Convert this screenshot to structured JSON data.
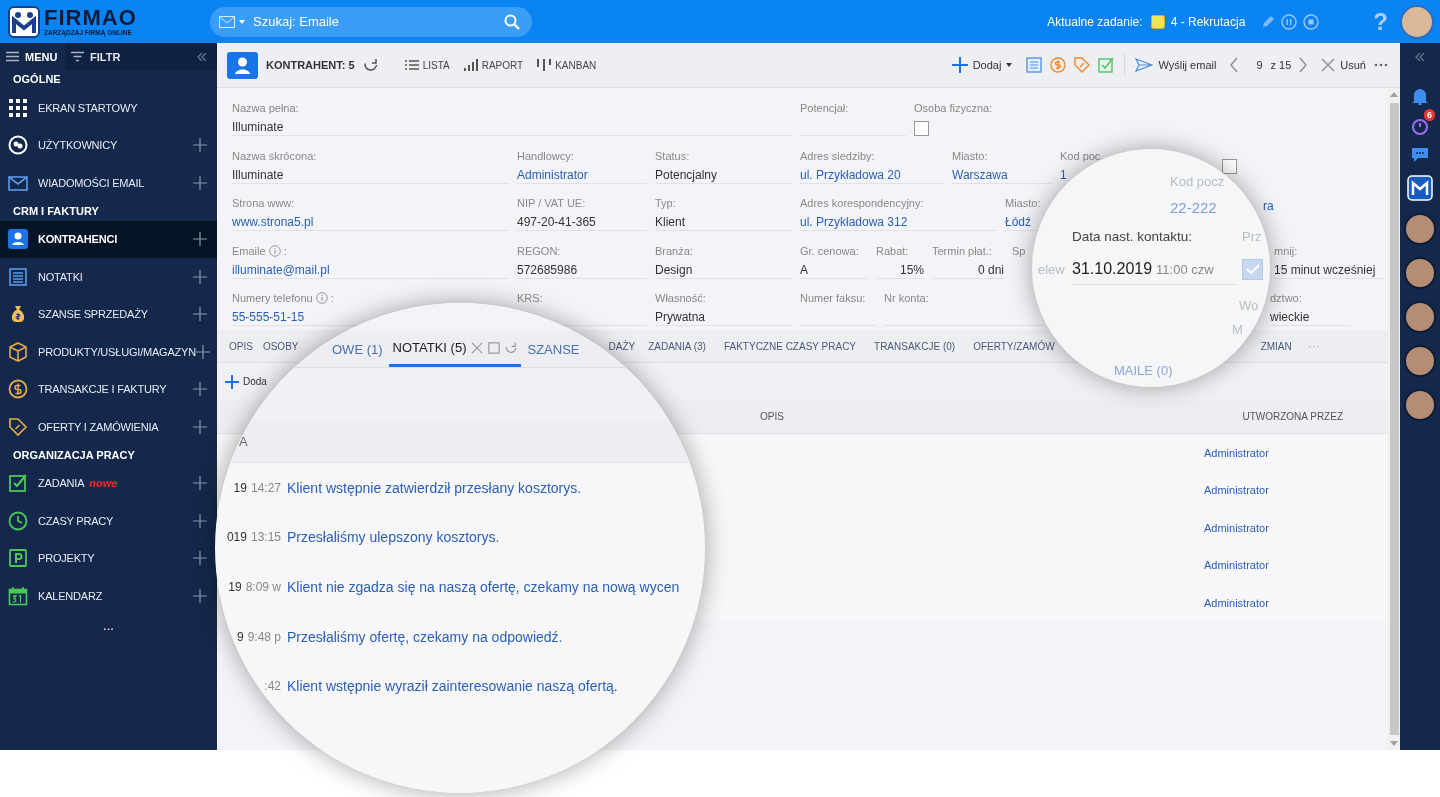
{
  "header": {
    "logo": {
      "name": "FIRMAO",
      "tagline": "ZARZĄDZAJ FIRMĄ ONLINE"
    },
    "search": {
      "placeholder": "Szukaj: Emaile"
    },
    "current_task": {
      "label": "Aktualne zadanie:",
      "name": "4 - Rekrutacja"
    },
    "help": "?"
  },
  "sidebar": {
    "tabs": [
      {
        "label": "MENU",
        "selected": true
      },
      {
        "label": "FILTR",
        "selected": false
      }
    ],
    "sections": [
      {
        "title": "OGÓLNE",
        "items": [
          {
            "label": "EKRAN STARTOWY",
            "kind": "grid",
            "selected": false,
            "addable": false
          },
          {
            "label": "UŻYTKOWNICY",
            "kind": "users",
            "selected": false,
            "addable": true
          },
          {
            "label": "WIADOMOŚCI EMAIL",
            "kind": "mail",
            "selected": false,
            "addable": true
          }
        ]
      },
      {
        "title": "CRM I FAKTURY",
        "items": [
          {
            "label": "KONTRAHENCI",
            "kind": "contact",
            "selected": true,
            "addable": true
          },
          {
            "label": "NOTATKI",
            "kind": "notes",
            "selected": false,
            "addable": true
          },
          {
            "label": "SZANSE SPRZEDAŻY",
            "kind": "bag",
            "selected": false,
            "addable": true
          },
          {
            "label": "PRODUKTY/USŁUGI/MAGAZYN",
            "kind": "box",
            "selected": false,
            "addable": true
          },
          {
            "label": "TRANSAKCJE I FAKTURY",
            "kind": "dollar",
            "selected": false,
            "addable": true
          },
          {
            "label": "OFERTY I ZAMÓWIENIA",
            "kind": "tag",
            "selected": false,
            "addable": true
          }
        ]
      },
      {
        "title": "ORGANIZACJA PRACY",
        "items": [
          {
            "label": "ZADANIA",
            "badge": "nowe",
            "kind": "check",
            "selected": false,
            "addable": true
          },
          {
            "label": "CZASY PRACY",
            "kind": "clock",
            "selected": false,
            "addable": true
          },
          {
            "label": "PROJEKTY",
            "kind": "project",
            "selected": false,
            "addable": true
          },
          {
            "label": "KALENDARZ",
            "kind": "calendar",
            "selected": false,
            "addable": true
          }
        ]
      }
    ],
    "more": "..."
  },
  "toolbar": {
    "title": "KONTRAHENT: 5",
    "views": [
      {
        "label": "LISTA",
        "kind": "list"
      },
      {
        "label": "RAPORT",
        "kind": "report"
      },
      {
        "label": "KANBAN",
        "kind": "kanban"
      }
    ],
    "add": "Dodaj",
    "send_email": "Wyślij email",
    "pager": {
      "current": "9",
      "total": "z 15"
    },
    "delete": "Usuń"
  },
  "form": {
    "rows": [
      {
        "fields": [
          {
            "label": "Nazwa pełna:",
            "value": "Illuminate",
            "kind": "text"
          },
          {
            "label": "Potencjał:",
            "kind": "text"
          },
          {
            "label": "Osoba fizyczna:",
            "kind": "checkbox",
            "checked": false
          }
        ]
      },
      {
        "fields": [
          {
            "label": "Nazwa skrócona:",
            "value": "Illuminate",
            "kind": "text"
          },
          {
            "label": "Handlowcy:",
            "value": "Administrator",
            "kind": "link"
          },
          {
            "label": "Status:",
            "value": "Potencjalny",
            "kind": "text"
          },
          {
            "label": "Adres siedziby:",
            "value": "ul. Przykładowa 20",
            "kind": "link"
          },
          {
            "label": "Miasto:",
            "value": "Warszawa",
            "kind": "link"
          },
          {
            "label": "Kod poc",
            "value": "1",
            "kind": "link"
          },
          {
            "kind": "checkbox",
            "checked": false
          }
        ]
      },
      {
        "fields": [
          {
            "label": "Strona www:",
            "value": "www.strona5.pl",
            "kind": "link"
          },
          {
            "label": "NIP / VAT UE:",
            "value": "497-20-41-365",
            "kind": "text"
          },
          {
            "label": "Typ:",
            "value": "Klient",
            "kind": "text"
          },
          {
            "label": "Adres korespondencyjny:",
            "value": "ul. Przykładowa 312",
            "kind": "link"
          },
          {
            "label": "Miasto:",
            "value": "Łódź",
            "kind": "link"
          },
          {
            "value": "ra",
            "kind": "link"
          }
        ]
      },
      {
        "fields": [
          {
            "label": "Emaile",
            "info": true,
            "suffix": ":",
            "value": "illuminate@mail.pl",
            "kind": "link"
          },
          {
            "label": "REGON:",
            "value": "572685986",
            "kind": "text"
          },
          {
            "label": "Branża:",
            "value": "Design",
            "kind": "text"
          },
          {
            "label": "Gr. cenowa:",
            "value": "A",
            "kind": "text"
          },
          {
            "label": "Rabat:",
            "value": "15%",
            "kind": "number"
          },
          {
            "label": "Termin płat.:",
            "value": "0 dni",
            "kind": "number"
          },
          {
            "label": "Sp",
            "kind": "text"
          },
          {
            "label": "mnij:",
            "value": "15 minut wcześniej",
            "kind": "text"
          }
        ]
      },
      {
        "fields": [
          {
            "label": "Numery telefonu",
            "info": true,
            "suffix": ":",
            "value": "55-555-51-15",
            "kind": "link"
          },
          {
            "label": "KRS:",
            "kind": "text"
          },
          {
            "label": "Własność:",
            "value": "Prywatna",
            "kind": "text"
          },
          {
            "label": "Numer faksu:",
            "kind": "text"
          },
          {
            "label": "Nr konta:",
            "kind": "text"
          },
          {
            "label": "dztwo:",
            "value": "wieckie",
            "kind": "text"
          }
        ]
      }
    ]
  },
  "tabs": {
    "items": [
      {
        "label": "OPIS",
        "selected": false
      },
      {
        "label": "OSOBY",
        "selected": false
      },
      {
        "label": "DAŻY",
        "selected": false
      },
      {
        "label": "ZADANIA (3)",
        "selected": false
      },
      {
        "label": "FAKTYCZNE CZASY PRACY",
        "selected": false
      },
      {
        "label": "TRANSAKCJE (0)",
        "selected": false
      },
      {
        "label": "OFERTY/ZAMÓW",
        "selected": false
      },
      {
        "label": "ZMIAN",
        "selected": false
      }
    ],
    "more": "···"
  },
  "notes": {
    "add": "Doda",
    "columns": [
      "OPIS",
      "UTWORZONA PRZEZ"
    ],
    "rows": [
      {
        "created_by": "Administrator"
      },
      {
        "created_by": "Administrator"
      },
      {
        "created_by": "Administrator"
      },
      {
        "created_by": "Administrator"
      },
      {
        "created_by": "Administrator"
      }
    ]
  },
  "magnifier_notes": {
    "tabs": [
      {
        "label": "OWE (1)",
        "selected": false
      },
      {
        "label": "NOTATKI (5)",
        "selected": true
      },
      {
        "label": "SZANSE",
        "selected": false
      }
    ],
    "header": "A",
    "rows": [
      {
        "date": "19",
        "time": "14:27",
        "description": "Klient wstępnie zatwierdził przesłany kosztorys."
      },
      {
        "date": "019",
        "time": "13:15",
        "description": "Przesłaliśmy ulepszony kosztorys."
      },
      {
        "date": "19",
        "time": "8:09 w",
        "description": "Klient nie zgadza się na naszą ofertę, czekamy na nową wycen"
      },
      {
        "date": "9",
        "time": "9:48 p",
        "description": "Przesłaliśmy ofertę, czekamy na odpowiedź."
      },
      {
        "time": ":42",
        "description": "Klient wstępnie wyraził zainteresowanie naszą ofertą."
      }
    ]
  },
  "magnifier_contact": {
    "postal_label": "Kod pocz",
    "postal_value": "22-222",
    "contact_label": "Data nast. kontaktu:",
    "reminder_label": "Prz",
    "transfer_fragment": "elew",
    "contact_date": "31.10.2019",
    "contact_time": "11:00 czw",
    "reminder_checked": true,
    "fragment_1": "Wo",
    "fragment_2": "M",
    "tab_fragment": "MAILE (0)"
  },
  "right_bar": {
    "notifications": "6"
  }
}
